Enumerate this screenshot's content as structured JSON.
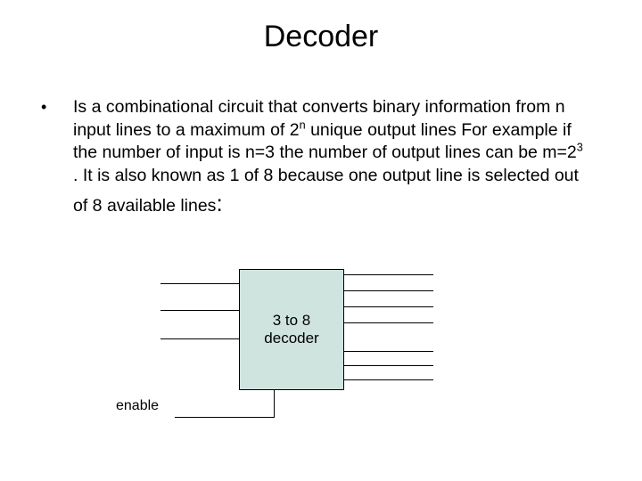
{
  "title": "Decoder",
  "bullet_text_parts": {
    "p1": "Is a combinational circuit that converts binary information from n input lines to a maximum of 2",
    "sup1": "n",
    "p2": " unique output lines For example if the number of input is n=3 the number of output lines can be  m=2",
    "sup2": "3",
    "p3": " . It is also known as 1 of 8 because one output line is selected out of 8 available lines",
    "colon": ":"
  },
  "box_label_line1": "3 to 8",
  "box_label_line2": "decoder",
  "enable_label": "enable"
}
